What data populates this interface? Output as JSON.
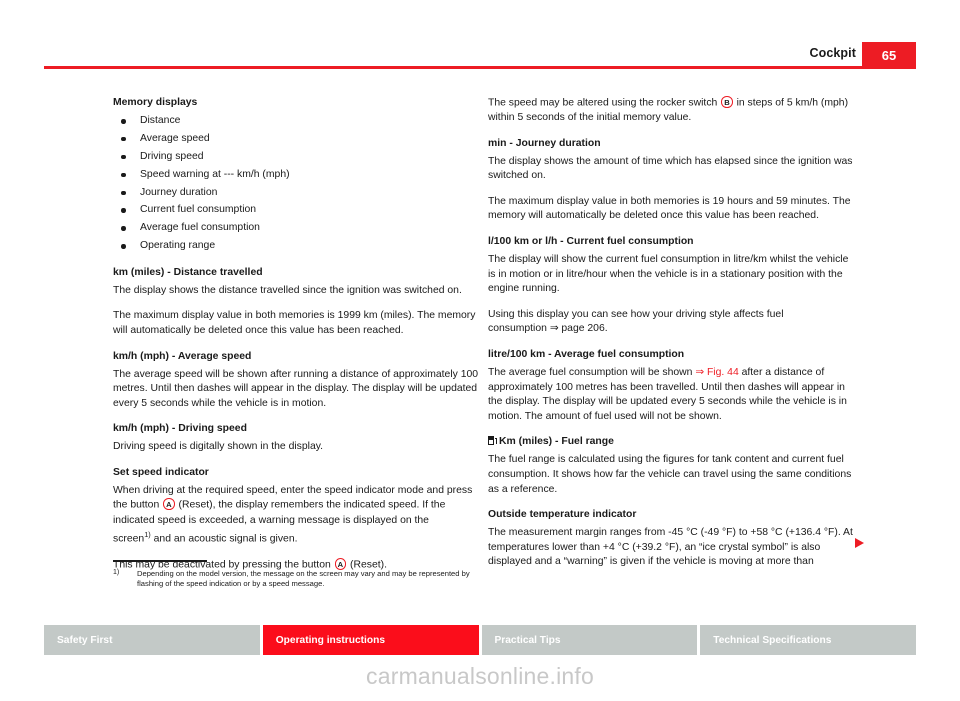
{
  "header": {
    "title": "Cockpit",
    "page_number": "65",
    "accent_color": "#ed1c24"
  },
  "left_column": {
    "memory_displays": {
      "heading": "Memory displays",
      "items": [
        "Distance",
        "Average speed",
        "Driving speed",
        "Speed warning at --- km/h (mph)",
        "Journey duration",
        "Current fuel consumption",
        "Average fuel consumption",
        "Operating range"
      ]
    },
    "distance": {
      "heading": "km (miles) - Distance travelled",
      "p1": "The display shows the distance travelled since the ignition was switched on.",
      "p2": "The maximum display value in both memories is 1999 km (miles). The memory will automatically be deleted once this value has been reached."
    },
    "average_speed": {
      "heading": "km/h (mph) - Average speed",
      "p1": "The average speed will be shown after running a distance of approximately 100 metres. Until then dashes will appear in the display. The display will be updated every 5 seconds while the vehicle is in motion."
    },
    "driving_speed": {
      "heading": "km/h (mph) - Driving speed",
      "p1": "Driving speed is digitally shown in the display."
    },
    "set_speed_indicator": {
      "heading": "Set speed indicator",
      "p1_a": "When driving at the required speed, enter the speed indicator mode and press the button",
      "marker_a": "A",
      "p1_b": "(Reset), the display remembers the indicated speed. If the indicated speed is exceeded, a warning message is displayed on the screen",
      "footnote_ref": "1)",
      "p1_c": "and an acoustic signal is given.",
      "p2_a": "This may be deactivated by pressing the button",
      "p2_marker": "A",
      "p2_b": "(Reset)."
    }
  },
  "right_column": {
    "rocker_switch": {
      "p1_a": "The speed may be altered using the rocker switch",
      "marker_b": "B",
      "p1_b": "in steps of 5 km/h (mph) within 5 seconds of the initial memory value."
    },
    "journey_duration": {
      "heading": "min - Journey duration",
      "p1": "The display shows the amount of time which has elapsed since the ignition was switched on.",
      "p2": "The maximum display value in both memories is 19 hours and 59 minutes. The memory will automatically be deleted once this value has been reached."
    },
    "current_fuel_consumption": {
      "heading": "l/100 km or l/h - Current fuel consumption",
      "p1": "The display will show the current fuel consumption in litre/km whilst the vehicle is in motion or in litre/hour when the vehicle is in a stationary position with the engine running.",
      "p2_a": "Using this display you can see how your driving style affects fuel consumption",
      "p2_ref": "⇒ page 206",
      "p2_b": "."
    },
    "average_fuel_consumption": {
      "heading": "litre/100 km - Average fuel consumption",
      "p1_a": "The average fuel consumption will be shown",
      "p1_ref": "⇒ Fig. 44",
      "p1_b": "after a distance of approximately 100 metres has been travelled. Until then dashes will appear in the display. The display will be updated every 5 seconds while the vehicle is in motion. The amount of fuel used will not be shown."
    },
    "fuel_range": {
      "icon": "fuel-pump-icon",
      "heading": "Km (miles) - Fuel range",
      "p1": "The fuel range is calculated using the figures for tank content and current fuel consumption. It shows how far the vehicle can travel using the same conditions as a reference."
    },
    "outside_temperature": {
      "heading": "Outside temperature indicator",
      "p1": "The measurement margin ranges from -45 °C (-49 °F) to +58 °C (+136.4 °F). At temperatures lower than +4 °C (+39.2 °F), an “ice crystal symbol” is also displayed and a “warning” is given if the vehicle is moving at more than"
    }
  },
  "footnote": {
    "marker": "1)",
    "text": "Depending on the model version, the message on the screen may vary and may be represented by flashing of the speed indication or by a speed message."
  },
  "footer": {
    "tabs": [
      {
        "label": "Safety First",
        "active": false
      },
      {
        "label": "Operating instructions",
        "active": true
      },
      {
        "label": "Practical Tips",
        "active": false
      },
      {
        "label": "Technical Specifications",
        "active": false
      }
    ],
    "active_color": "#fb0d1b",
    "inactive_color": "#c3c9c7"
  },
  "watermark": {
    "text": "carmanualsonline.info"
  }
}
